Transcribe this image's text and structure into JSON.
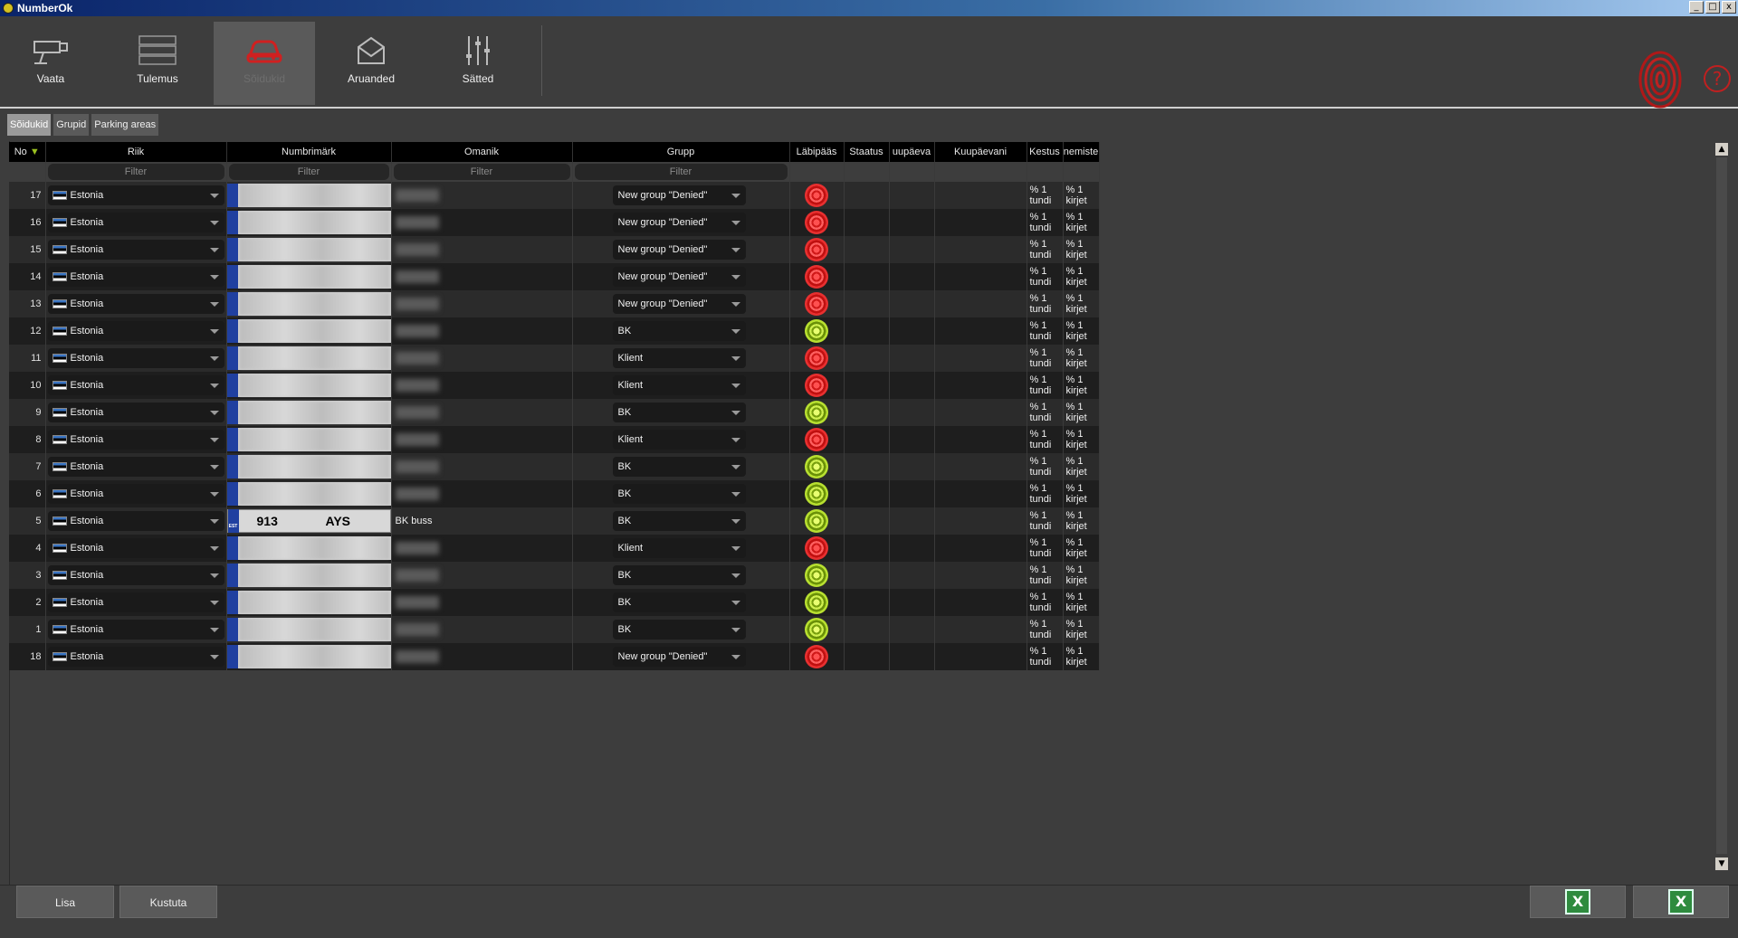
{
  "window": {
    "title": "NumberOk",
    "btn_min": "_",
    "btn_max": "□",
    "btn_close": "x"
  },
  "toolbar": {
    "items": [
      {
        "label": "Vaata",
        "icon": "camera-icon"
      },
      {
        "label": "Tulemus",
        "icon": "results-icon"
      },
      {
        "label": "Sõidukid",
        "icon": "car-icon"
      },
      {
        "label": "Aruanded",
        "icon": "reports-icon"
      },
      {
        "label": "Sätted",
        "icon": "sliders-icon"
      }
    ],
    "help": "?"
  },
  "subtabs": [
    "Sõidukid",
    "Grupid",
    "Parking areas"
  ],
  "table": {
    "headers": [
      "No",
      "Riik",
      "Numbrimärk",
      "Omanik",
      "Grupp",
      "Läbipääs",
      "Staatus",
      "uupäeva",
      "Kuupäevani",
      "Kestus",
      "nemiste"
    ],
    "filter_placeholder": "Filter",
    "rows": [
      {
        "no": "17",
        "country": "Estonia",
        "plate": "",
        "owner": "",
        "group": "New group \"Denied\"",
        "access": "red",
        "k1": "% 1",
        "k2": "tundi",
        "n1": "% 1",
        "n2": "kirjet"
      },
      {
        "no": "16",
        "country": "Estonia",
        "plate": "",
        "owner": "",
        "group": "New group \"Denied\"",
        "access": "red",
        "k1": "% 1",
        "k2": "tundi",
        "n1": "% 1",
        "n2": "kirjet"
      },
      {
        "no": "15",
        "country": "Estonia",
        "plate": "",
        "owner": "",
        "group": "New group \"Denied\"",
        "access": "red",
        "k1": "% 1",
        "k2": "tundi",
        "n1": "% 1",
        "n2": "kirjet"
      },
      {
        "no": "14",
        "country": "Estonia",
        "plate": "",
        "owner": "",
        "group": "New group \"Denied\"",
        "access": "red",
        "k1": "% 1",
        "k2": "tundi",
        "n1": "% 1",
        "n2": "kirjet"
      },
      {
        "no": "13",
        "country": "Estonia",
        "plate": "",
        "owner": "",
        "group": "New group \"Denied\"",
        "access": "red",
        "k1": "% 1",
        "k2": "tundi",
        "n1": "% 1",
        "n2": "kirjet"
      },
      {
        "no": "12",
        "country": "Estonia",
        "plate": "",
        "owner": "",
        "group": "BK",
        "access": "green",
        "k1": "% 1",
        "k2": "tundi",
        "n1": "% 1",
        "n2": "kirjet"
      },
      {
        "no": "11",
        "country": "Estonia",
        "plate": "",
        "owner": "",
        "group": "Klient",
        "access": "red",
        "k1": "% 1",
        "k2": "tundi",
        "n1": "% 1",
        "n2": "kirjet"
      },
      {
        "no": "10",
        "country": "Estonia",
        "plate": "",
        "owner": "",
        "group": "Klient",
        "access": "red",
        "k1": "% 1",
        "k2": "tundi",
        "n1": "% 1",
        "n2": "kirjet"
      },
      {
        "no": "9",
        "country": "Estonia",
        "plate": "",
        "owner": "",
        "group": "BK",
        "access": "green",
        "k1": "% 1",
        "k2": "tundi",
        "n1": "% 1",
        "n2": "kirjet"
      },
      {
        "no": "8",
        "country": "Estonia",
        "plate": "",
        "owner": "",
        "group": "Klient",
        "access": "red",
        "k1": "% 1",
        "k2": "tundi",
        "n1": "% 1",
        "n2": "kirjet"
      },
      {
        "no": "7",
        "country": "Estonia",
        "plate": "",
        "owner": "",
        "group": "BK",
        "access": "green",
        "k1": "% 1",
        "k2": "tundi",
        "n1": "% 1",
        "n2": "kirjet"
      },
      {
        "no": "6",
        "country": "Estonia",
        "plate": "",
        "owner": "",
        "group": "BK",
        "access": "green",
        "k1": "% 1",
        "k2": "tundi",
        "n1": "% 1",
        "n2": "kirjet"
      },
      {
        "no": "5",
        "country": "Estonia",
        "plate_num": "913",
        "plate_let": "AYS",
        "plate_cc": "EST",
        "owner": "BK buss",
        "group": "BK",
        "access": "green",
        "k1": "% 1",
        "k2": "tundi",
        "n1": "% 1",
        "n2": "kirjet"
      },
      {
        "no": "4",
        "country": "Estonia",
        "plate": "",
        "owner": "",
        "group": "Klient",
        "access": "red",
        "k1": "% 1",
        "k2": "tundi",
        "n1": "% 1",
        "n2": "kirjet"
      },
      {
        "no": "3",
        "country": "Estonia",
        "plate": "",
        "owner": "",
        "group": "BK",
        "access": "green",
        "k1": "% 1",
        "k2": "tundi",
        "n1": "% 1",
        "n2": "kirjet"
      },
      {
        "no": "2",
        "country": "Estonia",
        "plate": "",
        "owner": "",
        "group": "BK",
        "access": "green",
        "k1": "% 1",
        "k2": "tundi",
        "n1": "% 1",
        "n2": "kirjet"
      },
      {
        "no": "1",
        "country": "Estonia",
        "plate": "",
        "owner": "",
        "group": "BK",
        "access": "green",
        "k1": "% 1",
        "k2": "tundi",
        "n1": "% 1",
        "n2": "kirjet"
      },
      {
        "no": "18",
        "country": "Estonia",
        "plate": "",
        "owner": "",
        "group": "New group \"Denied\"",
        "access": "red",
        "k1": "% 1",
        "k2": "tundi",
        "n1": "% 1",
        "n2": "kirjet"
      }
    ]
  },
  "bottom": {
    "add": "Lisa",
    "delete": "Kustuta",
    "export1_icon": "excel-export-icon",
    "export2_icon": "excel-import-icon"
  },
  "colors": {
    "denied": "#d01a1a",
    "allowed": "#7aa010",
    "active_tab": "#9a9a9a"
  }
}
